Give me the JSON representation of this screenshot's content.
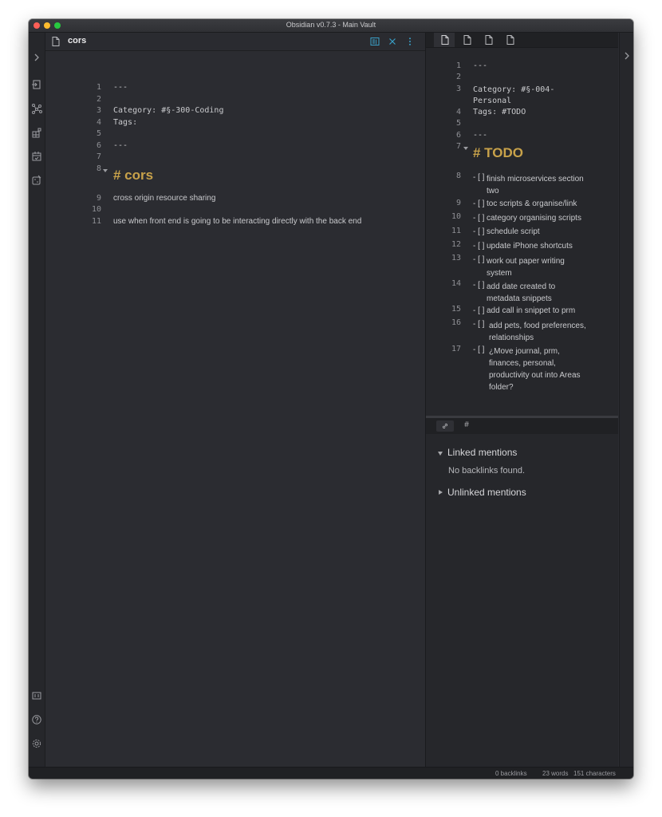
{
  "window": {
    "title": "Obsidian v0.7.3 - Main Vault"
  },
  "left_pane": {
    "title": "cors",
    "frontmatter": [
      {
        "n": "1",
        "text": "---"
      },
      {
        "n": "2",
        "text": ""
      },
      {
        "n": "3",
        "text": "Category: #§-300-Coding"
      },
      {
        "n": "4",
        "text": "Tags:"
      },
      {
        "n": "5",
        "text": ""
      },
      {
        "n": "6",
        "text": "---"
      },
      {
        "n": "7",
        "text": ""
      }
    ],
    "heading": {
      "n": "8",
      "text": "# cors"
    },
    "body": [
      {
        "n": "9",
        "text": "cross origin resource sharing"
      },
      {
        "n": "10",
        "text": ""
      },
      {
        "n": "11",
        "text": "use when front end is going to be interacting directly with the back end"
      }
    ]
  },
  "right_pane": {
    "frontmatter": [
      {
        "n": "1",
        "text": "---"
      },
      {
        "n": "2",
        "text": ""
      },
      {
        "n": "3",
        "text": "Category: #§-004-\nPersonal"
      },
      {
        "n": "4",
        "text": "Tags: #TODO"
      },
      {
        "n": "5",
        "text": ""
      },
      {
        "n": "6",
        "text": "---"
      }
    ],
    "heading": {
      "n": "7",
      "text": "# TODO"
    },
    "tasks": [
      {
        "n": "8",
        "prefix": "- [ ]",
        "text": "finish microservices section two"
      },
      {
        "n": "9",
        "prefix": "- [ ]",
        "text": "toc scripts & organise/link"
      },
      {
        "n": "10",
        "prefix": "- [ ]",
        "text": "category organising scripts"
      },
      {
        "n": "11",
        "prefix": "- [ ]",
        "text": "schedule script"
      },
      {
        "n": "12",
        "prefix": "- [ ]",
        "text": "update iPhone shortcuts"
      },
      {
        "n": "13",
        "prefix": "- [ ]",
        "text": "work out paper writing system"
      },
      {
        "n": "14",
        "prefix": "- [ ]",
        "text": "add date created to metadata snippets"
      },
      {
        "n": "15",
        "prefix": "- [ ]",
        "text": "add call in snippet to prm"
      },
      {
        "n": "16",
        "prefix": "- [ ]",
        "text": "add pets, food preferences, relationships"
      },
      {
        "n": "17",
        "prefix": "- [ ]",
        "text": "¿Move journal, prm, finances, personal, productivity out into Areas folder?"
      }
    ]
  },
  "backlinks": {
    "linked_label": "Linked mentions",
    "empty_text": "No backlinks found.",
    "unlinked_label": "Unlinked mentions",
    "tab_hash": "#"
  },
  "statusbar": {
    "backlinks": "0 backlinks",
    "words": "23 words",
    "characters": "151 characters"
  },
  "colors": {
    "heading": "#c8a24a",
    "accent": "#3aa0c8",
    "background": "#2b2c31"
  },
  "icons": [
    "chevron-right-icon",
    "open-file-icon",
    "graph-icon",
    "plugin-grid-icon",
    "calendar-icon",
    "random-dice-icon",
    "vault-icon",
    "help-icon",
    "settings-icon",
    "file-icon",
    "preview-icon",
    "close-icon",
    "more-options-icon",
    "link-icon"
  ]
}
